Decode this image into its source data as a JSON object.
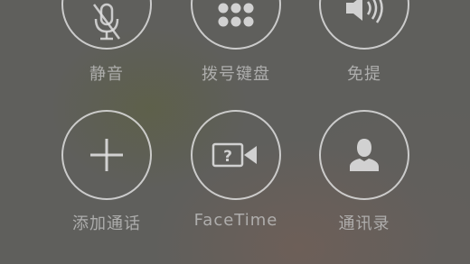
{
  "call_controls": {
    "row1": [
      {
        "label": "静音",
        "icon": "mic-muted-icon"
      },
      {
        "label": "拨号键盘",
        "icon": "keypad-icon"
      },
      {
        "label": "免提",
        "icon": "speaker-icon"
      }
    ],
    "row2": [
      {
        "label": "添加通话",
        "icon": "plus-icon"
      },
      {
        "label": "FaceTime",
        "icon": "facetime-camera-icon"
      },
      {
        "label": "通讯录",
        "icon": "contact-person-icon"
      }
    ]
  },
  "colors": {
    "ring": "#dedede",
    "label": "#bebebe",
    "background": "#5f5f5c"
  }
}
